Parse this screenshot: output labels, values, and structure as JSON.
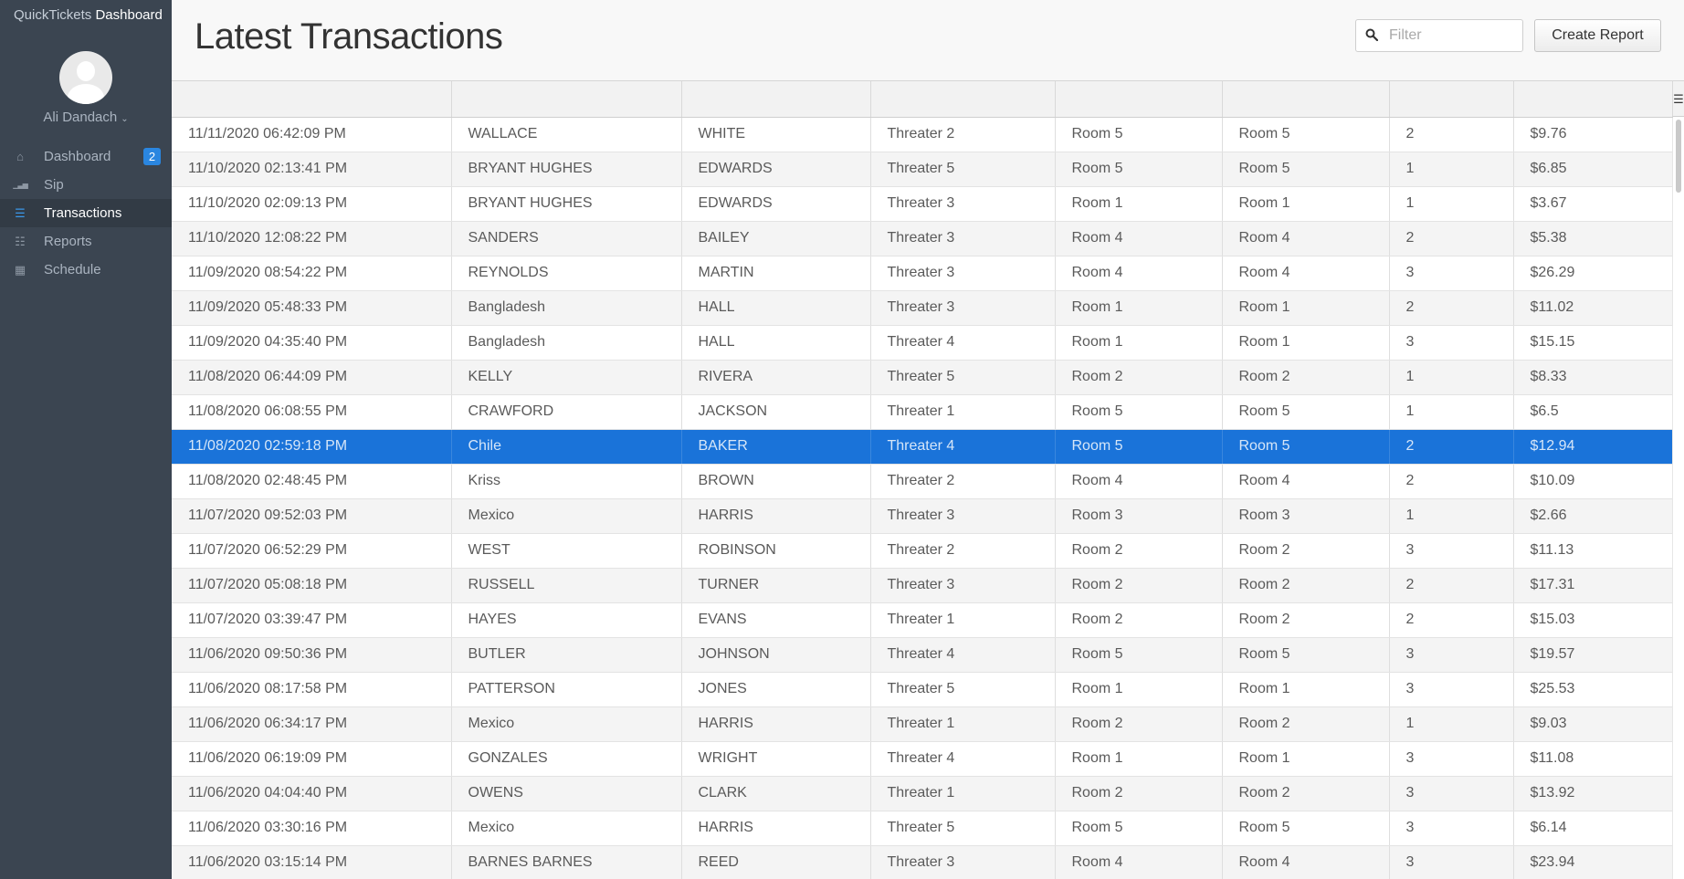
{
  "sidebar": {
    "brand_prefix": "QuickTickets",
    "brand_suffix": "Dashboard",
    "user_name": "Ali Dandach",
    "items": [
      {
        "label": "Dashboard",
        "icon": "home-icon",
        "badge": "2",
        "active": false
      },
      {
        "label": "Sip",
        "icon": "bar-chart-icon",
        "badge": "",
        "active": false
      },
      {
        "label": "Transactions",
        "icon": "grid-table-icon",
        "badge": "",
        "active": true
      },
      {
        "label": "Reports",
        "icon": "document-icon",
        "badge": "",
        "active": false
      },
      {
        "label": "Schedule",
        "icon": "calendar-icon",
        "badge": "",
        "active": false
      }
    ]
  },
  "header": {
    "title": "Latest Transactions",
    "filter_placeholder": "Filter",
    "filter_value": "",
    "create_report_label": "Create Report"
  },
  "colors": {
    "sidebar_bg": "#3b4551",
    "accent": "#2a86e0",
    "selected_row": "#1a73d9"
  },
  "table": {
    "selected_row_index": 9,
    "rows": [
      [
        "11/11/2020 06:42:09 PM",
        "WALLACE",
        "WHITE",
        "Threater 2",
        "Room 5",
        "Room 5",
        "2",
        "$9.76"
      ],
      [
        "11/10/2020 02:13:41 PM",
        "BRYANT HUGHES",
        "EDWARDS",
        "Threater 5",
        "Room 5",
        "Room 5",
        "1",
        "$6.85"
      ],
      [
        "11/10/2020 02:09:13 PM",
        "BRYANT HUGHES",
        "EDWARDS",
        "Threater 3",
        "Room 1",
        "Room 1",
        "1",
        "$3.67"
      ],
      [
        "11/10/2020 12:08:22 PM",
        "SANDERS",
        "BAILEY",
        "Threater 3",
        "Room 4",
        "Room 4",
        "2",
        "$5.38"
      ],
      [
        "11/09/2020 08:54:22 PM",
        "REYNOLDS",
        "MARTIN",
        "Threater 3",
        "Room 4",
        "Room 4",
        "3",
        "$26.29"
      ],
      [
        "11/09/2020 05:48:33 PM",
        "Bangladesh",
        "HALL",
        "Threater 3",
        "Room 1",
        "Room 1",
        "2",
        "$11.02"
      ],
      [
        "11/09/2020 04:35:40 PM",
        "Bangladesh",
        "HALL",
        "Threater 4",
        "Room 1",
        "Room 1",
        "3",
        "$15.15"
      ],
      [
        "11/08/2020 06:44:09 PM",
        "KELLY",
        "RIVERA",
        "Threater 5",
        "Room 2",
        "Room 2",
        "1",
        "$8.33"
      ],
      [
        "11/08/2020 06:08:55 PM",
        "CRAWFORD",
        "JACKSON",
        "Threater 1",
        "Room 5",
        "Room 5",
        "1",
        "$6.5"
      ],
      [
        "11/08/2020 02:59:18 PM",
        "Chile",
        "BAKER",
        "Threater 4",
        "Room 5",
        "Room 5",
        "2",
        "$12.94"
      ],
      [
        "11/08/2020 02:48:45 PM",
        "Kriss",
        "BROWN",
        "Threater 2",
        "Room 4",
        "Room 4",
        "2",
        "$10.09"
      ],
      [
        "11/07/2020 09:52:03 PM",
        "Mexico",
        "HARRIS",
        "Threater 3",
        "Room 3",
        "Room 3",
        "1",
        "$2.66"
      ],
      [
        "11/07/2020 06:52:29 PM",
        "WEST",
        "ROBINSON",
        "Threater 2",
        "Room 2",
        "Room 2",
        "3",
        "$11.13"
      ],
      [
        "11/07/2020 05:08:18 PM",
        "RUSSELL",
        "TURNER",
        "Threater 3",
        "Room 2",
        "Room 2",
        "2",
        "$17.31"
      ],
      [
        "11/07/2020 03:39:47 PM",
        "HAYES",
        "EVANS",
        "Threater 1",
        "Room 2",
        "Room 2",
        "2",
        "$15.03"
      ],
      [
        "11/06/2020 09:50:36 PM",
        "BUTLER",
        "JOHNSON",
        "Threater 4",
        "Room 5",
        "Room 5",
        "3",
        "$19.57"
      ],
      [
        "11/06/2020 08:17:58 PM",
        "PATTERSON",
        "JONES",
        "Threater 5",
        "Room 1",
        "Room 1",
        "3",
        "$25.53"
      ],
      [
        "11/06/2020 06:34:17 PM",
        "Mexico",
        "HARRIS",
        "Threater 1",
        "Room 2",
        "Room 2",
        "1",
        "$9.03"
      ],
      [
        "11/06/2020 06:19:09 PM",
        "GONZALES",
        "WRIGHT",
        "Threater 4",
        "Room 1",
        "Room 1",
        "3",
        "$11.08"
      ],
      [
        "11/06/2020 04:04:40 PM",
        "OWENS",
        "CLARK",
        "Threater 1",
        "Room 2",
        "Room 2",
        "3",
        "$13.92"
      ],
      [
        "11/06/2020 03:30:16 PM",
        "Mexico",
        "HARRIS",
        "Threater 5",
        "Room 5",
        "Room 5",
        "3",
        "$6.14"
      ],
      [
        "11/06/2020 03:15:14 PM",
        "BARNES BARNES",
        "REED",
        "Threater 3",
        "Room 4",
        "Room 4",
        "3",
        "$23.94"
      ]
    ]
  }
}
